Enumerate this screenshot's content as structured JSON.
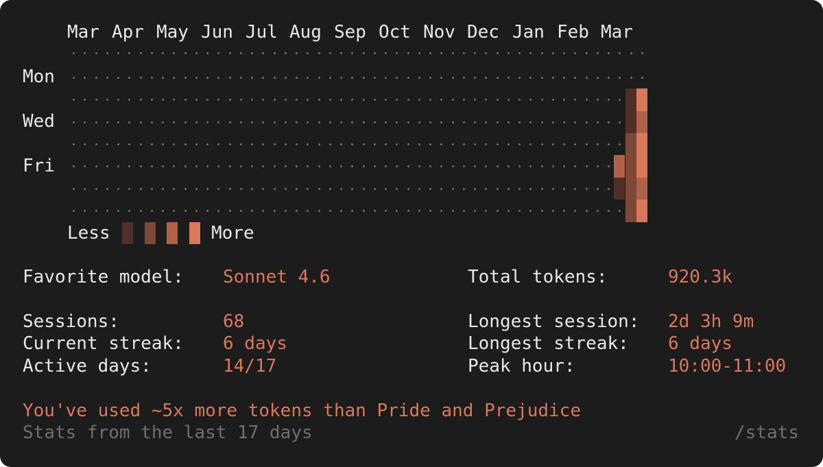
{
  "heatmap": {
    "months": [
      "Mar",
      "Apr",
      "May",
      "Jun",
      "Jul",
      "Aug",
      "Sep",
      "Oct",
      "Nov",
      "Dec",
      "Jan",
      "Feb",
      "Mar"
    ],
    "day_labels": [
      "Mon",
      "Wed",
      "Fri"
    ],
    "activity_levels": [
      {
        "column": 0,
        "levels": [
          0,
          0,
          0,
          0,
          3,
          1,
          0
        ]
      },
      {
        "column": 1,
        "levels": [
          0,
          1,
          1,
          2,
          2,
          2,
          2
        ]
      },
      {
        "column": 2,
        "levels": [
          0,
          4,
          3,
          4,
          4,
          3,
          4
        ]
      }
    ],
    "colors": {
      "empty_dot": "#707070",
      "level1": "#4e3029",
      "level2": "#7c4837",
      "level3": "#b06148",
      "level4": "#d9785a"
    }
  },
  "legend": {
    "less_label": "Less",
    "more_label": "More"
  },
  "stats": {
    "favorite_model_label": "Favorite model:",
    "favorite_model_value": "Sonnet 4.6",
    "total_tokens_label": "Total tokens:",
    "total_tokens_value": "920.3k",
    "sessions_label": "Sessions:",
    "sessions_value": "68",
    "longest_session_label": "Longest session:",
    "longest_session_value": "2d 3h 9m",
    "current_streak_label": "Current streak:",
    "current_streak_value": "6 days",
    "longest_streak_label": "Longest streak:",
    "longest_streak_value": "6 days",
    "active_days_label": "Active days:",
    "active_days_value": "14/17",
    "peak_hour_label": "Peak hour:",
    "peak_hour_value": "10:00-11:00"
  },
  "footer": {
    "fun_fact": "You've used ~5x more tokens than Pride and Prejudice",
    "period_note": "Stats from the last 17 days",
    "command": "/stats"
  },
  "colors": {
    "background": "#1c1c1c",
    "text": "#e8e8e8",
    "accent": "#d9785a",
    "muted": "#6e6e6e"
  }
}
